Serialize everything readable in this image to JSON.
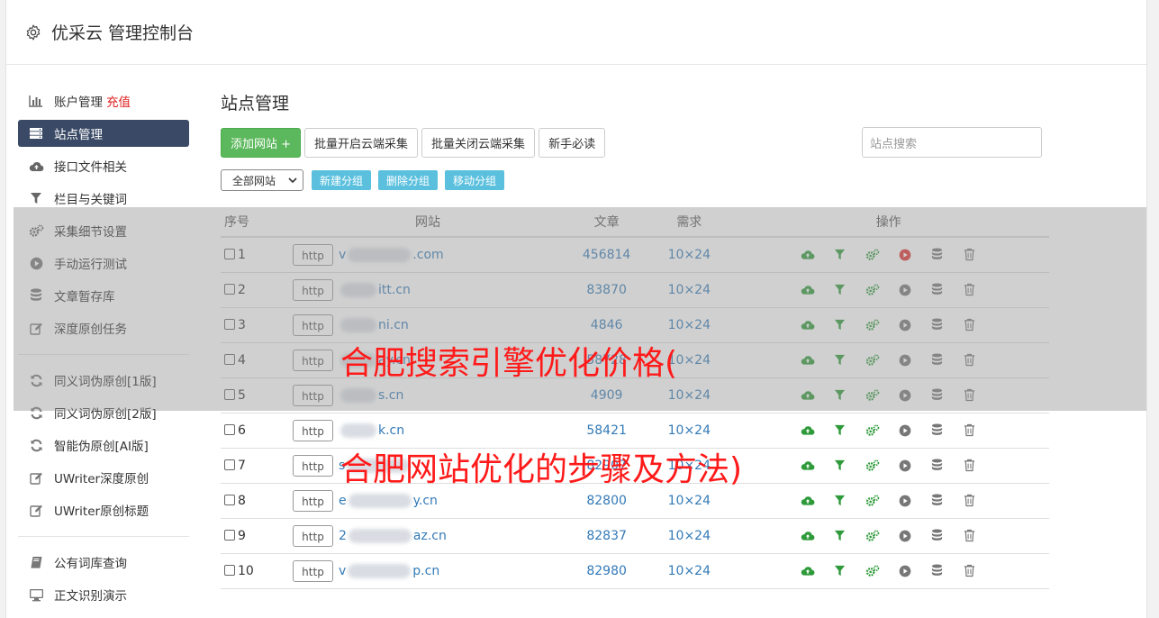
{
  "app": {
    "title": "优采云 管理控制台"
  },
  "sidebar": {
    "group1": [
      {
        "label": "账户管理",
        "badge": "充值",
        "icon": "bar-chart-icon"
      },
      {
        "label": "站点管理",
        "icon": "server-icon",
        "active": true
      },
      {
        "label": "接口文件相关",
        "icon": "cloud-upload-icon"
      },
      {
        "label": "栏目与关键词",
        "icon": "filter-icon"
      },
      {
        "label": "采集细节设置",
        "icon": "gears-icon"
      },
      {
        "label": "手动运行测试",
        "icon": "play-circle-icon"
      },
      {
        "label": "文章暂存库",
        "icon": "database-icon"
      },
      {
        "label": "深度原创任务",
        "icon": "edit-icon"
      }
    ],
    "group2": [
      {
        "label": "同义词伪原创[1版]",
        "icon": "refresh-icon"
      },
      {
        "label": "同义词伪原创[2版]",
        "icon": "refresh-icon"
      },
      {
        "label": "智能伪原创[AI版]",
        "icon": "refresh-icon"
      },
      {
        "label": "UWriter深度原创",
        "icon": "edit-icon"
      },
      {
        "label": "UWriter原创标题",
        "icon": "edit-icon"
      }
    ],
    "group3": [
      {
        "label": "公有词库查询",
        "icon": "book-icon"
      },
      {
        "label": "正文识别演示",
        "icon": "monitor-icon"
      }
    ]
  },
  "main": {
    "title": "站点管理",
    "toolbar": {
      "add_site": "添加网站 +",
      "batch_on": "批量开启云端采集",
      "batch_off": "批量关闭云端采集",
      "guide": "新手必读",
      "search_placeholder": "站点搜索"
    },
    "group_select": "全部网站",
    "group_buttons": {
      "new": "新建分组",
      "delete": "删除分组",
      "move": "移动分组"
    },
    "table": {
      "headers": {
        "no": "序号",
        "site": "网站",
        "articles": "文章",
        "demand": "需求",
        "ops": "操作"
      },
      "rows": [
        {
          "no": "1",
          "http": "http",
          "prefix": "v",
          "suffix": ".com",
          "articles": "456814",
          "demand": "10×24",
          "running": true
        },
        {
          "no": "2",
          "http": "http",
          "prefix": "",
          "suffix": "itt.cn",
          "articles": "83870",
          "demand": "10×24",
          "running": false
        },
        {
          "no": "3",
          "http": "http",
          "prefix": "",
          "suffix": "ni.cn",
          "articles": "4846",
          "demand": "10×24",
          "running": false
        },
        {
          "no": "4",
          "http": "http",
          "prefix": "",
          "suffix": "ay.cn",
          "articles": "58728",
          "demand": "10×24",
          "running": false
        },
        {
          "no": "5",
          "http": "http",
          "prefix": "",
          "suffix": "s.cn",
          "articles": "4909",
          "demand": "10×24",
          "running": false
        },
        {
          "no": "6",
          "http": "http",
          "prefix": "",
          "suffix": "k.cn",
          "articles": "58421",
          "demand": "10×24",
          "running": false
        },
        {
          "no": "7",
          "http": "http",
          "prefix": "s",
          "suffix": "",
          "articles": "82907",
          "demand": "10×24",
          "running": false
        },
        {
          "no": "8",
          "http": "http",
          "prefix": "e",
          "suffix": "y.cn",
          "articles": "82800",
          "demand": "10×24",
          "running": false
        },
        {
          "no": "9",
          "http": "http",
          "prefix": "2",
          "suffix": "az.cn",
          "articles": "82837",
          "demand": "10×24",
          "running": false
        },
        {
          "no": "10",
          "http": "http",
          "prefix": "v",
          "suffix": "p.cn",
          "articles": "82980",
          "demand": "10×24",
          "running": false
        }
      ]
    }
  },
  "watermark": {
    "line1": "合肥搜索引擎优化价格(",
    "line2": "合肥网站优化的步骤及方法)"
  },
  "colors": {
    "nav_active": "#3a4a66",
    "green_btn": "#5cb85c",
    "info_btn": "#5bc0de",
    "link": "#337ab7",
    "recharge": "#e02020",
    "op_green": "#2e9a3a",
    "op_red": "#e03030",
    "watermark": "#ff1a1a"
  }
}
